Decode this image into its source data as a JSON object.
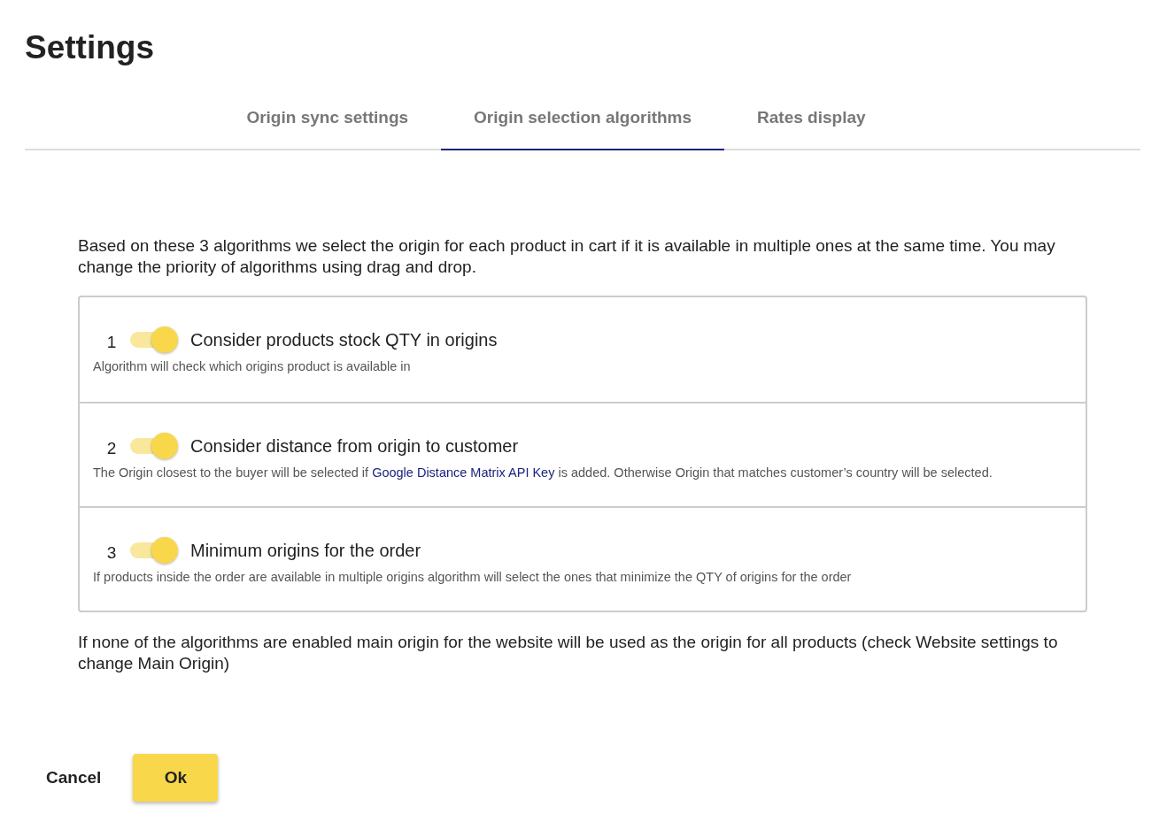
{
  "title": "Settings",
  "tabs": [
    {
      "label": "Origin sync settings",
      "selected": false
    },
    {
      "label": "Origin selection algorithms",
      "selected": true
    },
    {
      "label": "Rates display",
      "selected": false
    }
  ],
  "intro": "Based on these 3 algorithms we select the origin for each product in cart if it is available in multiple ones at the same time. You may change the priority of algorithms using drag and drop.",
  "algorithms": [
    {
      "number": "1",
      "on": true,
      "title": "Consider products stock QTY in origins",
      "description": {
        "before": "Algorithm will check which origins product is available in"
      }
    },
    {
      "number": "2",
      "on": true,
      "title": "Consider distance from origin to customer",
      "description": {
        "before": "The Origin closest to the buyer will be selected if ",
        "link": "Google Distance Matrix API Key",
        "after": " is added. Otherwise Origin that matches customer’s country will be selected."
      }
    },
    {
      "number": "3",
      "on": true,
      "title": "Minimum origins for the order",
      "description": {
        "before": "If products inside the order are available in multiple origins algorithm will select the ones that minimize the QTY of origins for the order"
      }
    }
  ],
  "footnote": "If none of the algorithms are enabled main origin for the website will be used as the origin for all products (check Website settings to change Main Origin)",
  "buttons": {
    "cancel": "Cancel",
    "ok": "Ok"
  }
}
